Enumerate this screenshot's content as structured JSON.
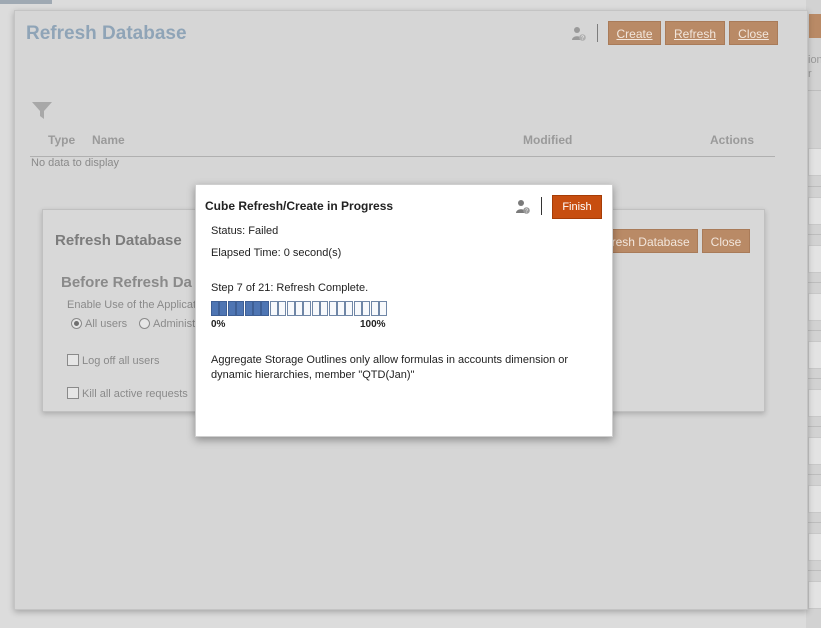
{
  "background": {
    "right_fragment_text": [
      "ion",
      "r"
    ]
  },
  "outer_dialog": {
    "title": "Refresh Database",
    "buttons": {
      "create": "Create",
      "refresh": "Refresh",
      "close": "Close"
    },
    "table": {
      "columns": [
        "Type",
        "Name",
        "Modified",
        "Actions"
      ],
      "empty_text": "No data to display"
    }
  },
  "middle_dialog": {
    "title": "Refresh Database",
    "section_title": "Before Refresh Da",
    "enable_label": "Enable Use of the Applicat",
    "radio_all_users": "All users",
    "radio_admins": "Administ",
    "chk_logoff": "Log off all users",
    "chk_kill": "Kill all active requests",
    "buttons": {
      "refresh_database": "fresh Database",
      "close": "Close"
    }
  },
  "modal": {
    "title": "Cube Refresh/Create in Progress",
    "finish_label": "Finish",
    "status": "Status: Failed",
    "elapsed": "Elapsed Time: 0 second(s)",
    "step": "Step 7 of 21: Refresh Complete.",
    "progress": {
      "completed_steps": 7,
      "total_steps": 21,
      "label_start": "0%",
      "label_end": "100%"
    },
    "message": "Aggregate Storage Outlines only allow formulas in accounts dimension or dynamic hierarchies, member \"QTD(Jan)\""
  },
  "colors": {
    "finish_button": "#c74e10",
    "progress_fill": "#4e75b3",
    "dim_button": "#b98a66",
    "outer_title": "#8fa4b7"
  }
}
